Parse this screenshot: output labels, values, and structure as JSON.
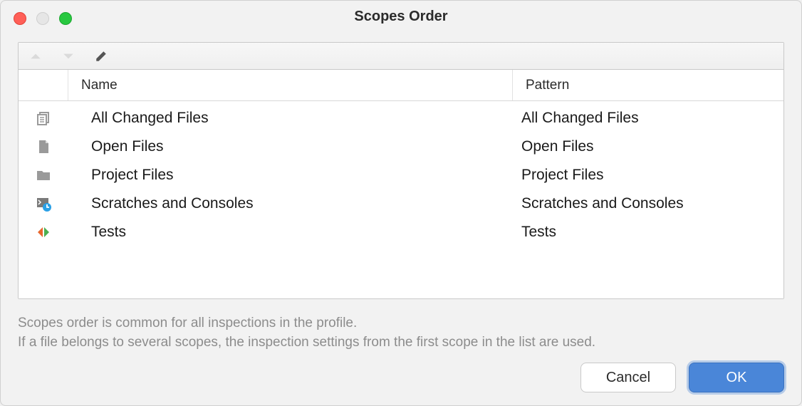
{
  "window": {
    "title": "Scopes Order"
  },
  "toolbar": {
    "move_up_enabled": false,
    "move_down_enabled": false,
    "edit_enabled": true
  },
  "columns": {
    "name": "Name",
    "pattern": "Pattern"
  },
  "rows": [
    {
      "icon": "doc-stack",
      "name": "All Changed Files",
      "pattern": "All Changed Files"
    },
    {
      "icon": "page-fold",
      "name": "Open Files",
      "pattern": "Open Files"
    },
    {
      "icon": "folder",
      "name": "Project Files",
      "pattern": "Project Files"
    },
    {
      "icon": "terminal-clock",
      "name": "Scratches and Consoles",
      "pattern": "Scratches and Consoles"
    },
    {
      "icon": "test-arrows",
      "name": "Tests",
      "pattern": "Tests"
    }
  ],
  "hint": {
    "line1": "Scopes order is common for all inspections in the profile.",
    "line2": "If a file belongs to several scopes, the inspection settings from the first scope in the list are used."
  },
  "buttons": {
    "cancel": "Cancel",
    "ok": "OK"
  }
}
